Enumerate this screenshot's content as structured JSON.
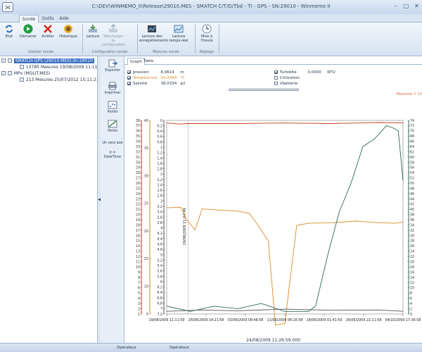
{
  "window": {
    "title": "C:\\DEV\\WINMEMO_II\\Release\\29010.MES - SMATCH C/T/D/Tbd - TI - GPS - SN:29010 - Winmemo II"
  },
  "tabs": [
    "Sonde",
    "Outils",
    "Aide"
  ],
  "ribbon": {
    "groups": [
      {
        "label": "Gestion sonde",
        "buttons": [
          "Etat",
          "Démarrer",
          "Arrêter",
          "Historique"
        ]
      },
      {
        "label": "Configuration sonde",
        "buttons": [
          "Lecture",
          "Télécharger la configuration"
        ]
      },
      {
        "label": "Mesures sonde",
        "buttons": [
          "Lecture des enregistrements",
          "Lecture temps-réel"
        ]
      },
      {
        "label": "Réglage",
        "buttons": [
          "Mise à l'heure"
        ]
      }
    ]
  },
  "tree": {
    "items": [
      {
        "label": "SMATCH-GPS (29010.MES),Sn:29010",
        "sub": "13785 Mesures 19/08/2009 11:11:5"
      },
      {
        "label": "MPx (MOLIT.MES)",
        "sub": "213 Mesures 25/07/2012 15:11:21"
      }
    ]
  },
  "tools": [
    "Exporter",
    "Imprimer",
    "Points",
    "Pente",
    "Un seul axe",
    "X = DateTime"
  ],
  "subtabs": [
    "Graph",
    "Table"
  ],
  "legend": {
    "left": [
      {
        "label": "pression",
        "value": "6,9614",
        "unit": "m",
        "checked": true,
        "color": "#2f2f2f"
      },
      {
        "label": "Température",
        "value": "24,2044",
        "unit": "°C",
        "checked": true,
        "color": "#d88a23"
      },
      {
        "label": "Salinité",
        "value": "38,0334",
        "unit": "g/l",
        "checked": true,
        "color": "#2f2f2f"
      }
    ],
    "right": [
      {
        "label": "Turbidité",
        "value": "0,0000",
        "unit": "NTU",
        "checked": true
      },
      {
        "label": "Chloration",
        "value": "",
        "unit": "",
        "checked": false
      },
      {
        "label": "Vbatterie",
        "value": "",
        "unit": "",
        "checked": false
      }
    ]
  },
  "moyenne": "Moyenne = 13",
  "status": [
    "Opérateur",
    "Opérateur"
  ],
  "chart_data": {
    "type": "line",
    "x_type": "datetime",
    "x_ticks": [
      "19/08/2009 11:11:59",
      "26/08/2009 14:21:58",
      "03/09/2009 09:48:58",
      "11/09/2009 06:16:58",
      "18/09/2009 01:41:59",
      "26/09/2009 22:11:58",
      "04/10/2009 17:36:58"
    ],
    "cursor_label": "19/08/2009 11:44:49",
    "date_label": "24/08/2009 11:26:59.000",
    "axes": [
      {
        "id": "salinite",
        "color": "#c33b20",
        "ticks": [
          38,
          37,
          36,
          35,
          34,
          33,
          32,
          31,
          30,
          29,
          28,
          27,
          26,
          25,
          24,
          23,
          22,
          21,
          20,
          19,
          18,
          17,
          16,
          15,
          14,
          13,
          12,
          11,
          10,
          9,
          8,
          7,
          6,
          5,
          4,
          3,
          2,
          1
        ]
      },
      {
        "id": "temperature",
        "color": "#d88a23",
        "ticks": [
          40,
          35,
          30,
          25,
          20,
          15,
          10,
          5
        ]
      },
      {
        "id": "pression",
        "color": "#555555",
        "ticks": [
          "0",
          "0,2",
          "0,4",
          "0,6",
          "0,8",
          "1",
          "1,2",
          "1,4",
          "1,6",
          "1,8",
          "2",
          "2,2",
          "2,4",
          "2,6",
          "2,8",
          "3",
          "3,2",
          "3,4",
          "3,6",
          "3,8",
          "4",
          "4,2",
          "4,4",
          "4,6",
          "4,8",
          "5",
          "5,2",
          "5,4",
          "5,6",
          "5,8",
          "6",
          "6,2",
          "6,4",
          "6,6",
          "6,8",
          "7",
          "7,2"
        ]
      },
      {
        "id": "turbidite",
        "color": "#2a6a5a",
        "ticks": [
          74,
          72,
          70,
          68,
          66,
          64,
          62,
          60,
          58,
          56,
          54,
          52,
          50,
          48,
          46,
          44,
          42,
          40,
          38,
          36,
          34,
          32,
          30,
          28,
          26,
          24,
          22,
          20,
          18,
          16,
          14,
          12,
          10,
          8,
          6,
          4,
          2,
          0
        ]
      }
    ],
    "series": [
      {
        "name": "Salinité",
        "color": "#c33b20",
        "x": [
          0,
          0.05,
          0.1,
          0.3,
          0.5,
          0.7,
          0.8,
          0.9,
          1.0
        ],
        "y": [
          37.5,
          37.3,
          37.4,
          37.4,
          37.5,
          37.4,
          37.5,
          37.6,
          37.5
        ]
      },
      {
        "name": "Température",
        "color": "#d88a23",
        "x": [
          0,
          0.06,
          0.08,
          0.12,
          0.15,
          0.22,
          0.3,
          0.35,
          0.38,
          0.43,
          0.46,
          0.5,
          0.55,
          0.6,
          0.7,
          0.8,
          0.9,
          0.97,
          1.0
        ],
        "y": [
          24.2,
          24.3,
          22.3,
          20.2,
          24.0,
          23.8,
          23.6,
          23.2,
          21.4,
          18.2,
          3.0,
          3.3,
          21.0,
          21.4,
          21.5,
          21.8,
          21.5,
          21.4,
          21.6
        ]
      },
      {
        "name": "Turbidité",
        "color": "#2a6a5a",
        "x": [
          0,
          0.1,
          0.2,
          0.3,
          0.4,
          0.5,
          0.6,
          0.63,
          0.68,
          0.73,
          0.78,
          0.83,
          0.88,
          0.91,
          0.93,
          0.96,
          0.98,
          1.0
        ],
        "y": [
          3,
          1,
          3,
          2,
          4,
          1,
          1,
          3,
          22,
          39,
          50,
          64,
          67,
          70,
          72,
          71,
          70,
          51
        ]
      },
      {
        "name": "pression",
        "color": "#555555",
        "x": [
          0,
          0.15,
          0.3,
          0.5,
          0.7,
          0.9,
          1.0
        ],
        "y": [
          7.1,
          7.05,
          7.08,
          7.02,
          7.06,
          7.05,
          7.1
        ]
      }
    ]
  }
}
